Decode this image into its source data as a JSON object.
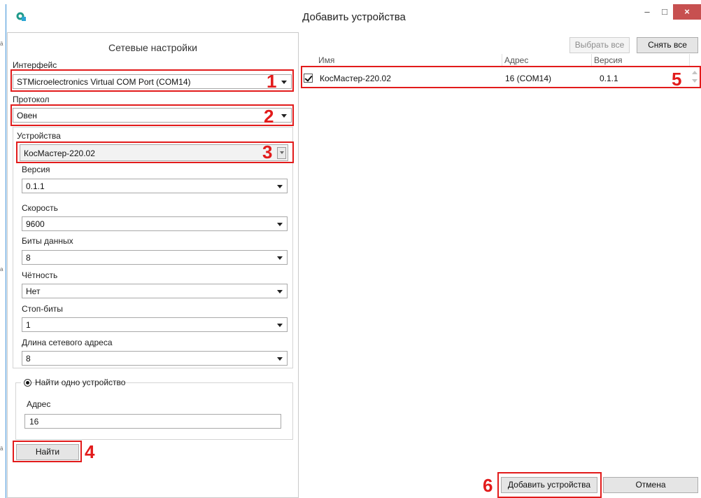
{
  "window": {
    "title": "Добавить устройства",
    "minimize_glyph": "–",
    "maximize_glyph": "□",
    "close_glyph": "×"
  },
  "network": {
    "section_title": "Сетевые настройки",
    "interface": {
      "label": "Интерфейс",
      "value": "STMicroelectronics Virtual COM Port (COM14)"
    },
    "protocol": {
      "label": "Протокол",
      "value": "Овен"
    },
    "devices": {
      "label": "Устройства",
      "value": "КосМастер-220.02"
    },
    "version": {
      "label": "Версия",
      "value": "0.1.1"
    },
    "speed": {
      "label": "Скорость",
      "value": "9600"
    },
    "data_bits": {
      "label": "Биты данных",
      "value": "8"
    },
    "parity": {
      "label": "Чётность",
      "value": "Нет"
    },
    "stop_bits": {
      "label": "Стоп-биты",
      "value": "1"
    },
    "address_length": {
      "label": "Длина сетевого адреса",
      "value": "8"
    }
  },
  "find": {
    "mode_label": "Найти одно устройство",
    "address_label": "Адрес",
    "address_value": "16",
    "find_button": "Найти"
  },
  "table_actions": {
    "select_all": "Выбрать все",
    "deselect_all": "Снять все"
  },
  "table": {
    "columns": [
      "Имя",
      "Адрес",
      "Версия"
    ],
    "rows": [
      {
        "checked": true,
        "name": "КосМастер-220.02",
        "address": "16 (COM14)",
        "version": "0.1.1"
      }
    ]
  },
  "footer": {
    "add_button": "Добавить устройства",
    "cancel_button": "Отмена"
  },
  "callouts": [
    "1",
    "2",
    "3",
    "4",
    "5",
    "6"
  ],
  "colors": {
    "callout_red": "#e21b1b",
    "close_button": "#c75050",
    "window_border": "#3a8fd6"
  },
  "icons": {
    "app": "app-logo-icon",
    "dropdown": "chevron-down-icon",
    "checkbox": "checkmark-icon",
    "radio": "radio-selected-icon"
  }
}
